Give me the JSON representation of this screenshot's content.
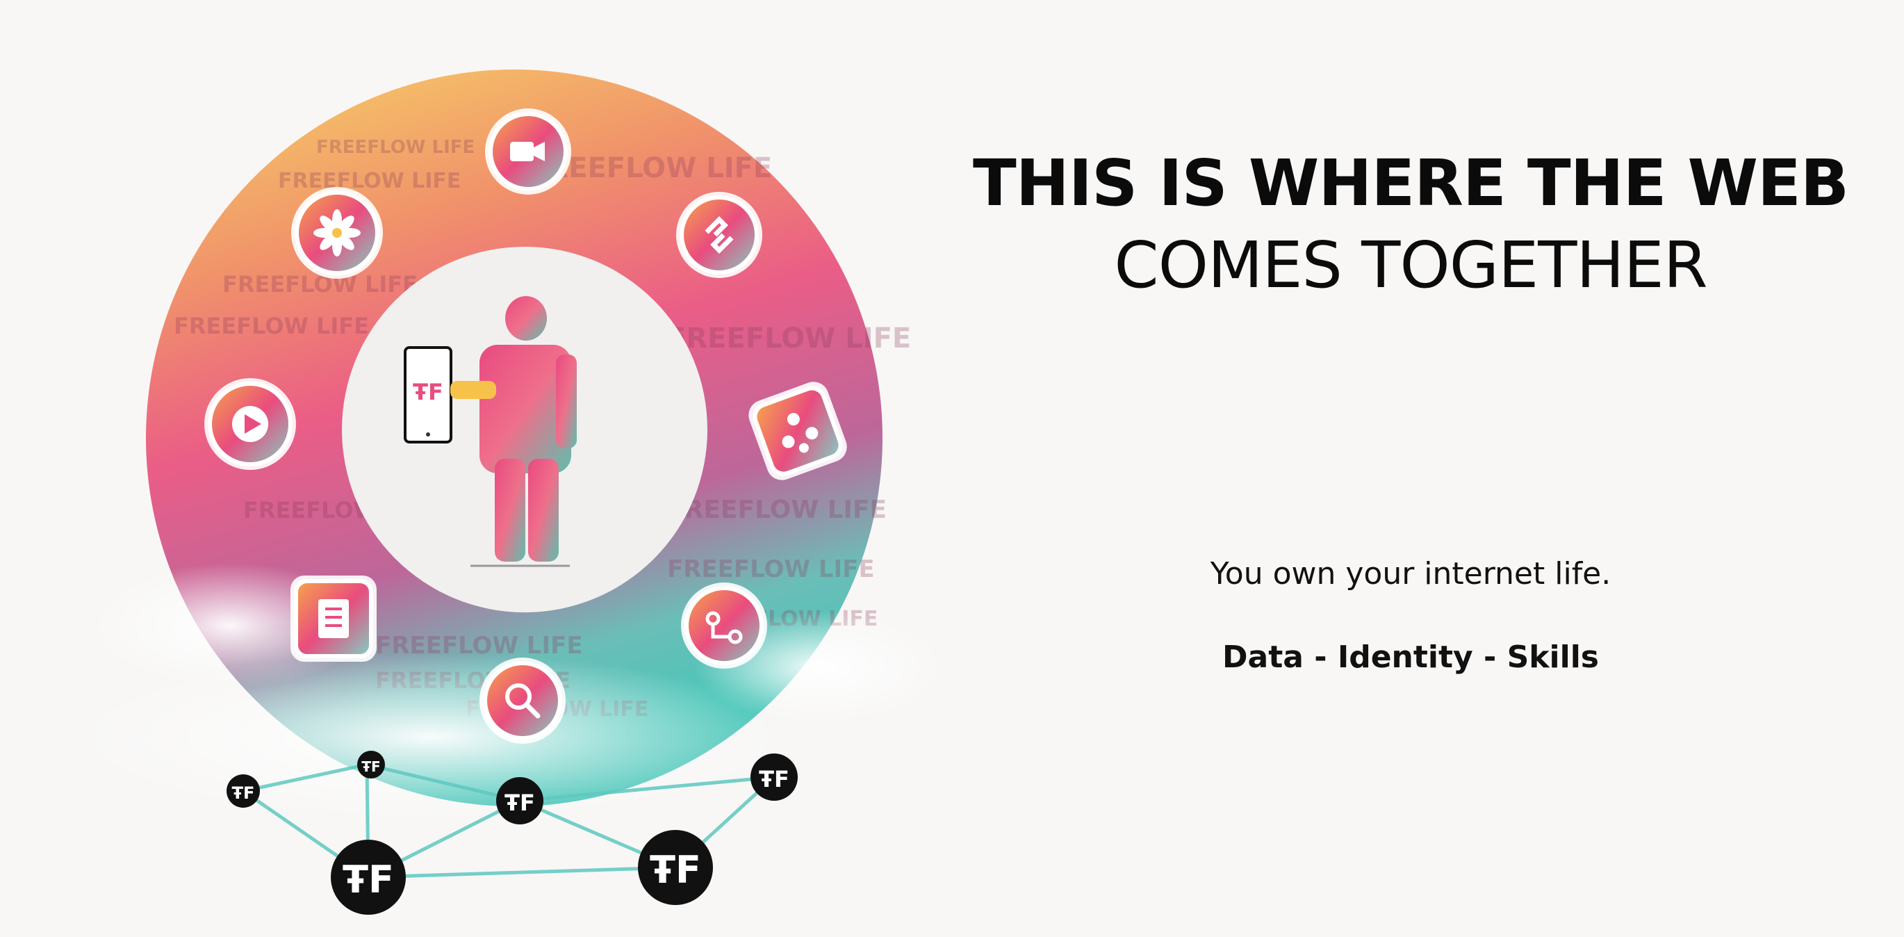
{
  "hero": {
    "headline_line1": "THIS IS WHERE THE WEB",
    "headline_line2": "COMES TOGETHER",
    "tagline": "You own your internet life.",
    "pillars": "Data - Identity - Skills"
  },
  "illustration": {
    "watermark_text": "FREEFLOW LIFE",
    "app_icons": [
      "video-camera-icon",
      "sync-arrows-icon",
      "team-icon",
      "route-icon",
      "search-icon",
      "document-icon",
      "play-icon",
      "flower-icon"
    ],
    "node_logo": "ŦF",
    "phone_logo": "ŦF"
  },
  "colors": {
    "background": "#f8f7f6",
    "text": "#0b0b0b",
    "accent_pink": "#e8477a",
    "accent_yellow": "#f6c94a",
    "accent_teal": "#3cc2b4",
    "node": "#111111"
  }
}
